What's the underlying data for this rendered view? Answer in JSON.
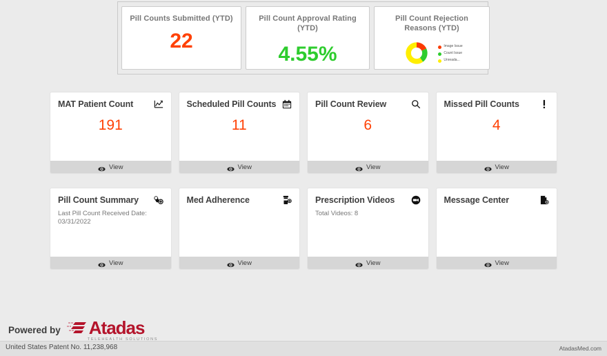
{
  "kpi": {
    "panels": [
      {
        "title": "Pill Counts Submitted (YTD)",
        "value": "22",
        "value_color": "#ff4105",
        "type": "number"
      },
      {
        "title": "Pill Count Approval Rating (YTD)",
        "value": "4.55%",
        "value_color": "#2ecc2e",
        "type": "number"
      },
      {
        "title": "Pill Count Rejection Reasons (YTD)",
        "type": "donut"
      }
    ],
    "panel1_title": "Pill Counts Submitted (YTD)",
    "panel1_value": "22",
    "panel2_title": "Pill Count Approval Rating (YTD)",
    "panel2_value": "4.55%",
    "panel3_title": "Pill Count Rejection Reasons (YTD)"
  },
  "chart_data": {
    "type": "pie",
    "title": "Pill Count Rejection Reasons (YTD)",
    "subtype": "donut",
    "categories": [
      "Image Issue",
      "Count Issue",
      "Unreadable"
    ],
    "values": [
      18,
      22,
      60
    ],
    "colors": [
      "#fb3b00",
      "#2ecc2e",
      "#ffee00"
    ],
    "legend": [
      {
        "label": "Image Issue",
        "display": "Image Issue",
        "color": "#fb3b00"
      },
      {
        "label": "Count Issue",
        "display": "Count Issue",
        "color": "#2ecc2e"
      },
      {
        "label": "Unreadable",
        "display": "Unreada...",
        "color": "#ffee00"
      }
    ],
    "legend_position": "right",
    "grid": false
  },
  "cards": [
    {
      "title": "MAT Patient Count",
      "icon": "line-chart-icon",
      "value": "191",
      "subtext": "",
      "action": "View"
    },
    {
      "title": "Scheduled Pill Counts",
      "icon": "calendar-icon",
      "value": "11",
      "subtext": "",
      "action": "View"
    },
    {
      "title": "Pill Count Review",
      "icon": "search-icon",
      "value": "6",
      "subtext": "",
      "action": "View"
    },
    {
      "title": "Missed Pill Counts",
      "icon": "exclamation-icon",
      "value": "4",
      "subtext": "",
      "action": "View"
    },
    {
      "title": "Pill Count Summary",
      "icon": "pills-icon",
      "value": "",
      "subtext": "Last Pill Count Received Date: 03/31/2022",
      "action": "View"
    },
    {
      "title": "Med Adherence",
      "icon": "pill-bottle-icon",
      "value": "",
      "subtext": "",
      "action": "View"
    },
    {
      "title": "Prescription Videos",
      "icon": "video-camera-icon",
      "value": "",
      "subtext": "Total Videos: 8",
      "action": "View"
    },
    {
      "title": "Message Center",
      "icon": "message-document-icon",
      "value": "",
      "subtext": "",
      "action": "View"
    }
  ],
  "footer": {
    "powered_by": "Powered by",
    "brand_name": "Atadas",
    "brand_tagline": "TELEHEALTH SOLUTIONS",
    "patent": "United States Patent No. 11,238,968",
    "site": "AtadasMed.com"
  },
  "colors": {
    "accent_orange": "#ff4105",
    "accent_green": "#2ecc2e",
    "brand_red": "#b4142b",
    "page_bg": "#ebebeb"
  }
}
